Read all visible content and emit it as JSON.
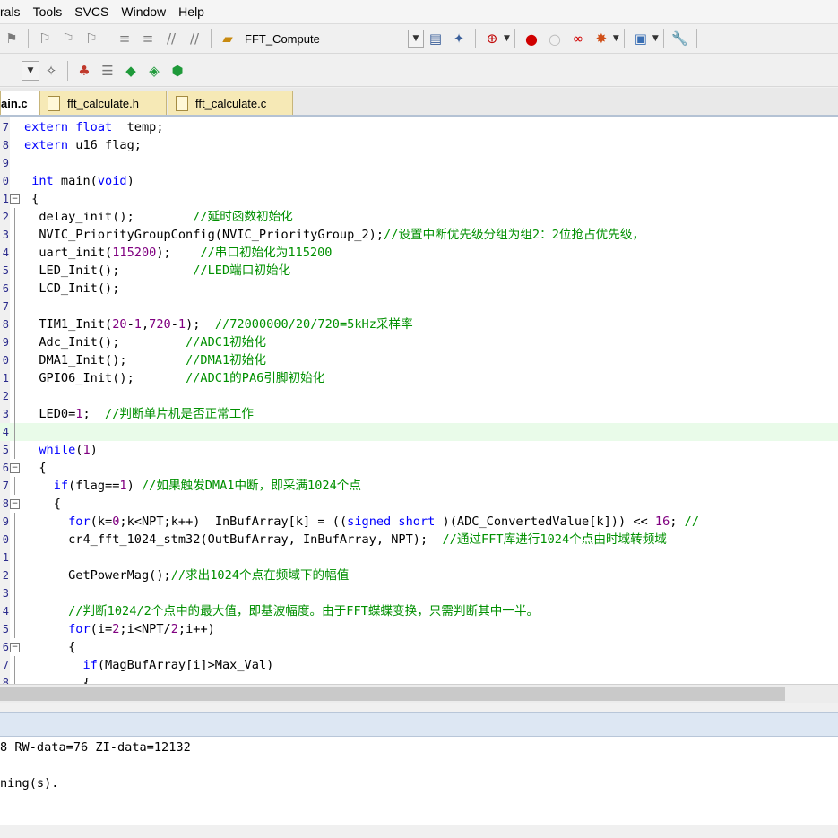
{
  "menu": [
    "rals",
    "Tools",
    "SVCS",
    "Window",
    "Help"
  ],
  "toolbar1": {
    "target_label": "FFT_Compute",
    "icons": [
      "bookmark-icon",
      "bookmark-prev-icon",
      "bookmark-next-icon",
      "bookmark-clear-icon",
      "indent-icon",
      "unindent-icon",
      "comment-icon",
      "uncomment-icon",
      "load-icon",
      "target-options-icon",
      "translate-icon",
      "debug-icon",
      "breakpoint-icon",
      "breakpoint-disable-icon",
      "breakpoint-clear-icon",
      "breakpoint-kill-icon",
      "window-icon",
      "config-icon"
    ]
  },
  "toolbar2": {
    "icons": [
      "dropdown-icon",
      "wizard-icon",
      "pack-installer-icon",
      "stack-icon",
      "diamond-icon",
      "tag-icon",
      "package-icon"
    ]
  },
  "tabs": [
    {
      "label": "ain.c",
      "active": true
    },
    {
      "label": "fft_calculate.h",
      "active": false
    },
    {
      "label": "fft_calculate.c",
      "active": false
    }
  ],
  "current_line": 17,
  "code_lines": [
    {
      "ln": "7",
      "fold": "",
      "t": [
        [
          "kw",
          "extern float"
        ],
        [
          "",
          "  temp;"
        ]
      ]
    },
    {
      "ln": "8",
      "fold": "",
      "t": [
        [
          "kw",
          "extern"
        ],
        [
          "",
          " u16 flag;"
        ]
      ]
    },
    {
      "ln": "9",
      "fold": "",
      "t": []
    },
    {
      "ln": "0",
      "fold": "",
      "t": [
        [
          "",
          " "
        ],
        [
          "kw",
          "int"
        ],
        [
          "",
          " main("
        ],
        [
          "kw",
          "void"
        ],
        [
          "",
          ")"
        ]
      ]
    },
    {
      "ln": "1",
      "fold": "box",
      "t": [
        [
          "",
          " {"
        ]
      ]
    },
    {
      "ln": "2",
      "fold": "line",
      "t": [
        [
          "",
          "  delay_init();        "
        ],
        [
          "com",
          "//延时函数初始化"
        ]
      ]
    },
    {
      "ln": "3",
      "fold": "line",
      "t": [
        [
          "",
          "  NVIC_PriorityGroupConfig(NVIC_PriorityGroup_2);"
        ],
        [
          "com",
          "//设置中断优先级分组为组2：2位抢占优先级，"
        ]
      ]
    },
    {
      "ln": "4",
      "fold": "line",
      "t": [
        [
          "",
          "  uart_init("
        ],
        [
          "num",
          "115200"
        ],
        [
          "",
          "); "
        ],
        [
          "com",
          "   //串口初始化为115200"
        ]
      ]
    },
    {
      "ln": "5",
      "fold": "line",
      "t": [
        [
          "",
          "  LED_Init();          "
        ],
        [
          "com",
          "//LED端口初始化"
        ]
      ]
    },
    {
      "ln": "6",
      "fold": "line",
      "t": [
        [
          "",
          "  LCD_Init();"
        ]
      ]
    },
    {
      "ln": "7",
      "fold": "line",
      "t": []
    },
    {
      "ln": "8",
      "fold": "line",
      "t": [
        [
          "",
          "  TIM1_Init("
        ],
        [
          "num",
          "20"
        ],
        [
          "",
          "-"
        ],
        [
          "num",
          "1"
        ],
        [
          "",
          ","
        ],
        [
          "num",
          "720"
        ],
        [
          "",
          "-"
        ],
        [
          "num",
          "1"
        ],
        [
          "",
          "); "
        ],
        [
          "com",
          " //72000000/20/720=5kHz采样率"
        ]
      ]
    },
    {
      "ln": "9",
      "fold": "line",
      "t": [
        [
          "",
          "  Adc_Init();         "
        ],
        [
          "com",
          "//ADC1初始化"
        ]
      ]
    },
    {
      "ln": "0",
      "fold": "line",
      "t": [
        [
          "",
          "  DMA1_Init();        "
        ],
        [
          "com",
          "//DMA1初始化"
        ]
      ]
    },
    {
      "ln": "1",
      "fold": "line",
      "t": [
        [
          "",
          "  GPIO6_Init();       "
        ],
        [
          "com",
          "//ADC1的PA6引脚初始化"
        ]
      ]
    },
    {
      "ln": "2",
      "fold": "line",
      "t": []
    },
    {
      "ln": "3",
      "fold": "line",
      "t": [
        [
          "",
          "  LED0="
        ],
        [
          "num",
          "1"
        ],
        [
          "",
          ";  "
        ],
        [
          "com",
          "//判断单片机是否正常工作"
        ]
      ]
    },
    {
      "ln": "4",
      "fold": "line",
      "t": []
    },
    {
      "ln": "5",
      "fold": "line",
      "t": [
        [
          "",
          "  "
        ],
        [
          "kw",
          "while"
        ],
        [
          "",
          "("
        ],
        [
          "num",
          "1"
        ],
        [
          "",
          ")"
        ]
      ]
    },
    {
      "ln": "6",
      "fold": "box",
      "t": [
        [
          "",
          "  {"
        ]
      ]
    },
    {
      "ln": "7",
      "fold": "line",
      "t": [
        [
          "",
          "    "
        ],
        [
          "kw",
          "if"
        ],
        [
          "",
          "(flag=="
        ],
        [
          "num",
          "1"
        ],
        [
          "",
          ") "
        ],
        [
          "com",
          "//如果触发DMA1中断，即采满1024个点"
        ]
      ]
    },
    {
      "ln": "8",
      "fold": "box",
      "t": [
        [
          "",
          "    {"
        ]
      ]
    },
    {
      "ln": "9",
      "fold": "line",
      "t": [
        [
          "",
          "      "
        ],
        [
          "kw",
          "for"
        ],
        [
          "",
          "(k="
        ],
        [
          "num",
          "0"
        ],
        [
          "",
          ";k<NPT;k++)  InBufArray[k] = (("
        ],
        [
          "kw",
          "signed short"
        ],
        [
          "",
          " )(ADC_ConvertedValue[k])) << "
        ],
        [
          "num",
          "16"
        ],
        [
          "",
          "; "
        ],
        [
          "com",
          "//"
        ]
      ]
    },
    {
      "ln": "0",
      "fold": "line",
      "t": [
        [
          "",
          "      cr4_fft_1024_stm32(OutBufArray, InBufArray, NPT);  "
        ],
        [
          "com",
          "//通过FFT库进行1024个点由时域转频域"
        ]
      ]
    },
    {
      "ln": "1",
      "fold": "line",
      "t": []
    },
    {
      "ln": "2",
      "fold": "line",
      "t": [
        [
          "",
          "      GetPowerMag();"
        ],
        [
          "com",
          "//求出1024个点在频域下的幅值"
        ]
      ]
    },
    {
      "ln": "3",
      "fold": "line",
      "t": []
    },
    {
      "ln": "4",
      "fold": "line",
      "t": [
        [
          "",
          "      "
        ],
        [
          "com",
          "//判断1024/2个点中的最大值，即基波幅度。由于FFT蝶蝶变换，只需判断其中一半。"
        ]
      ]
    },
    {
      "ln": "5",
      "fold": "line",
      "t": [
        [
          "",
          "      "
        ],
        [
          "kw",
          "for"
        ],
        [
          "",
          "(i="
        ],
        [
          "num",
          "2"
        ],
        [
          "",
          ";i<NPT/"
        ],
        [
          "num",
          "2"
        ],
        [
          "",
          ";i++)"
        ]
      ]
    },
    {
      "ln": "6",
      "fold": "box",
      "t": [
        [
          "",
          "      {"
        ]
      ]
    },
    {
      "ln": "7",
      "fold": "line",
      "t": [
        [
          "",
          "        "
        ],
        [
          "kw",
          "if"
        ],
        [
          "",
          "(MagBufArray[i]>Max_Val)"
        ]
      ]
    },
    {
      "ln": "8",
      "fold": "line",
      "t": [
        [
          "",
          "        {"
        ]
      ]
    }
  ],
  "output_lines": [
    "8 RW-data=76 ZI-data=12132",
    "",
    "ning(s)."
  ],
  "colors": {
    "keyword": "#0000ff",
    "number": "#800080",
    "comment": "#009000",
    "current_line_bg": "#e9fbe9",
    "tab_bg": "#f6e9b6"
  }
}
